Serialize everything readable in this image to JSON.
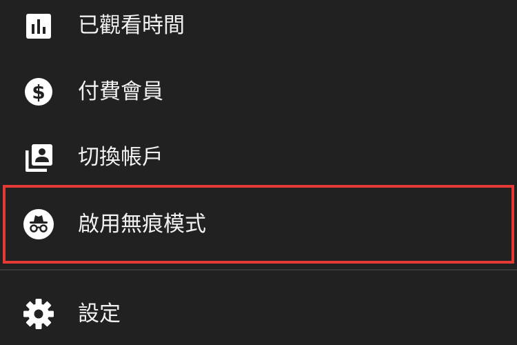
{
  "menu": {
    "items": [
      {
        "label": "已觀看時間",
        "icon": "bar-chart-icon"
      },
      {
        "label": "付費會員",
        "icon": "dollar-circle-icon"
      },
      {
        "label": "切換帳戶",
        "icon": "switch-account-icon"
      },
      {
        "label": "啟用無痕模式",
        "icon": "incognito-icon"
      },
      {
        "label": "設定",
        "icon": "gear-icon"
      }
    ]
  },
  "colors": {
    "background": "#212121",
    "text": "#f1f1f1",
    "highlight": "#e53935"
  }
}
